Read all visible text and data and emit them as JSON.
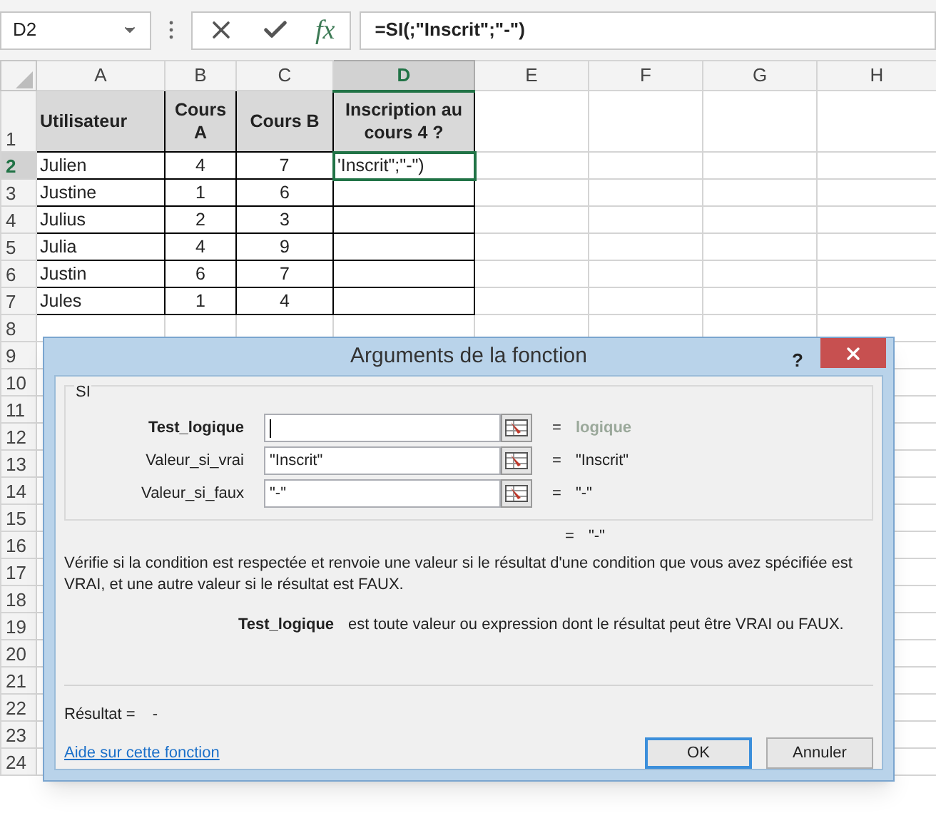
{
  "name_box": {
    "value": "D2"
  },
  "formula_bar": {
    "function_button": "fx",
    "value": "=SI(;\"Inscrit\";\"-\")"
  },
  "columns": [
    {
      "label": "A",
      "selected": false
    },
    {
      "label": "B",
      "selected": false
    },
    {
      "label": "C",
      "selected": false
    },
    {
      "label": "D",
      "selected": true
    },
    {
      "label": "E",
      "selected": false
    },
    {
      "label": "F",
      "selected": false
    },
    {
      "label": "G",
      "selected": false
    },
    {
      "label": "H",
      "selected": false
    }
  ],
  "rows": [
    {
      "label": "1",
      "selected": false,
      "cells": [
        {
          "text": "Utilisateur",
          "selected": false
        },
        {
          "text": "Cours A",
          "selected": false
        },
        {
          "text": "Cours B",
          "selected": false
        },
        {
          "text": "Inscription au cours 4 ?",
          "selected": false
        }
      ]
    },
    {
      "label": "2",
      "selected": true,
      "cells": [
        {
          "text": "Julien",
          "selected": false
        },
        {
          "text": "4",
          "selected": false
        },
        {
          "text": "7",
          "selected": false
        },
        {
          "text": "'Inscrit\";\"-\")",
          "selected": true
        }
      ]
    },
    {
      "label": "3",
      "selected": false,
      "cells": [
        {
          "text": "Justine",
          "selected": false
        },
        {
          "text": "1",
          "selected": false
        },
        {
          "text": "6",
          "selected": false
        },
        {
          "text": "",
          "selected": false
        }
      ]
    },
    {
      "label": "4",
      "selected": false,
      "cells": [
        {
          "text": "Julius",
          "selected": false
        },
        {
          "text": "2",
          "selected": false
        },
        {
          "text": "3",
          "selected": false
        },
        {
          "text": "",
          "selected": false
        }
      ]
    },
    {
      "label": "5",
      "selected": false,
      "cells": [
        {
          "text": "Julia",
          "selected": false
        },
        {
          "text": "4",
          "selected": false
        },
        {
          "text": "9",
          "selected": false
        },
        {
          "text": "",
          "selected": false
        }
      ]
    },
    {
      "label": "6",
      "selected": false,
      "cells": [
        {
          "text": "Justin",
          "selected": false
        },
        {
          "text": "6",
          "selected": false
        },
        {
          "text": "7",
          "selected": false
        },
        {
          "text": "",
          "selected": false
        }
      ]
    },
    {
      "label": "7",
      "selected": false,
      "cells": [
        {
          "text": "Jules",
          "selected": false
        },
        {
          "text": "1",
          "selected": false
        },
        {
          "text": "4",
          "selected": false
        },
        {
          "text": "",
          "selected": false
        }
      ]
    },
    {
      "label": "8",
      "selected": false
    },
    {
      "label": "9",
      "selected": false
    },
    {
      "label": "10",
      "selected": false
    },
    {
      "label": "11",
      "selected": false
    },
    {
      "label": "12",
      "selected": false
    },
    {
      "label": "13",
      "selected": false
    },
    {
      "label": "14",
      "selected": false
    },
    {
      "label": "15",
      "selected": false
    },
    {
      "label": "16",
      "selected": false
    },
    {
      "label": "17",
      "selected": false
    },
    {
      "label": "18",
      "selected": false
    },
    {
      "label": "19",
      "selected": false
    },
    {
      "label": "20",
      "selected": false
    },
    {
      "label": "21",
      "selected": false
    },
    {
      "label": "22",
      "selected": false
    },
    {
      "label": "23",
      "selected": false
    },
    {
      "label": "24",
      "selected": false
    }
  ],
  "dialog": {
    "title": "Arguments de la fonction",
    "help": "?",
    "function_name": "SI",
    "arguments": [
      {
        "label": "Test_logique",
        "selected": true,
        "equals": "=",
        "result": "logique",
        "result_is_hint": true
      },
      {
        "label": "Valeur_si_vrai",
        "value": "\"Inscrit\"",
        "selected": false,
        "equals": "=",
        "result": "\"Inscrit\"",
        "result_is_hint": false
      },
      {
        "label": "Valeur_si_faux",
        "value": "\"-\"",
        "selected": false,
        "equals": "=",
        "result": "\"-\"",
        "result_is_hint": false
      }
    ],
    "formula_result": {
      "equals": "=",
      "value": "\"-\""
    },
    "description": "Vérifie si la condition est respectée et renvoie une valeur si le résultat d'une condition que vous avez spécifiée est VRAI, et une autre valeur si le résultat est FAUX.",
    "argument_help": {
      "name": "Test_logique",
      "text": "est toute valeur ou expression dont le résultat peut être VRAI ou FAUX."
    },
    "result": {
      "label": "Résultat =",
      "value": "-"
    },
    "help_link": "Aide sur cette fonction",
    "buttons": [
      {
        "label": "OK",
        "selected": true
      },
      {
        "label": "Annuler",
        "selected": false
      }
    ]
  }
}
